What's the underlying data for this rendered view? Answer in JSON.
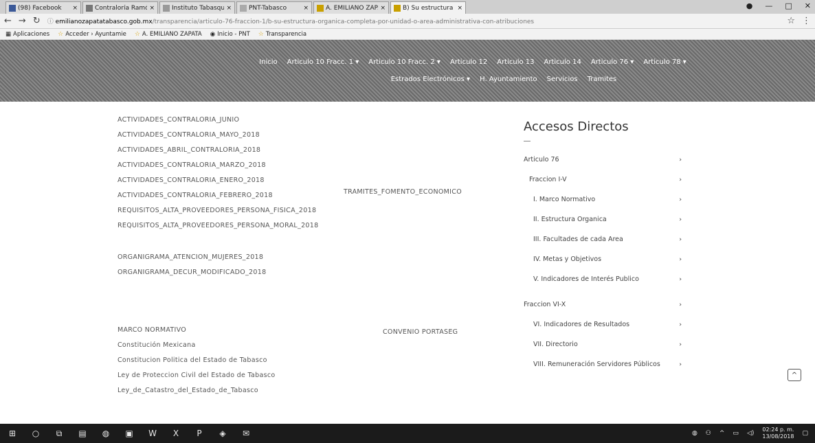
{
  "browser": {
    "tabs": [
      {
        "label": "(98) Facebook",
        "active": false
      },
      {
        "label": "Contraloría Ramón Solís",
        "active": false
      },
      {
        "label": "Instituto Tabasqueño de",
        "active": false
      },
      {
        "label": "PNT-Tabasco",
        "active": false
      },
      {
        "label": "A. EMILIANO ZAPATA",
        "active": false
      },
      {
        "label": "B) Su estructura orgánica",
        "active": true
      }
    ],
    "url_domain": "emilianozapatatabasco.gob.mx",
    "url_path": "/transparencia/articulo-76-fraccion-1/b-su-estructura-organica-completa-por-unidad-o-area-administrativa-con-atribuciones",
    "bookmarks": [
      "Aplicaciones",
      "Acceder › Ayuntamie",
      "A. EMILIANO ZAPATA",
      "Inicio - PNT",
      "Transparencia"
    ]
  },
  "site_nav": {
    "row1": [
      "Inicio",
      "Articulo 10 Fracc. 1 ▾",
      "Articulo 10 Fracc. 2 ▾",
      "Articulo 12",
      "Articulo 13",
      "Articulo 14",
      "Articulo 76 ▾",
      "Articulo 78 ▾"
    ],
    "row2": [
      "Estrados Electrónicos ▾",
      "H. Ayuntamiento",
      "Servicios",
      "Tramites"
    ]
  },
  "content": {
    "group1": [
      "ACTIVIDADES_CONTRALORIA_JUNIO",
      "ACTIVIDADES_CONTRALORIA_MAYO_2018",
      "ACTIVIDADES_ABRIL_CONTRALORIA_2018",
      "ACTIVIDADES_CONTRALORIA_MARZO_2018",
      "ACTIVIDADES_CONTRALORIA_ENERO_2018",
      "ACTIVIDADES_CONTRALORIA_FEBRERO_2018",
      "REQUISITOS_ALTA_PROVEEDORES_PERSONA_FISICA_2018",
      "REQUISITOS_ALTA_PROVEEDORES_PERSONA_MORAL_2018"
    ],
    "group2": [
      "ORGANIGRAMA_ATENCION_MUJERES_2018",
      "ORGANIGRAMA_DECUR_MODIFICADO_2018"
    ],
    "group3": [
      "MARCO NORMATIVO",
      "Constitución Mexicana",
      "Constitucion Politica del Estado de Tabasco",
      "Ley de Proteccion Civil del Estado de Tabasco",
      "Ley_de_Catastro_del_Estado_de_Tabasco"
    ],
    "mid_link_1": "TRAMITES_FOMENTO_ECONOMICO",
    "mid_link_2": "CONVENIO PORTASEG"
  },
  "sidebar": {
    "title": "Accesos Directos",
    "items": [
      {
        "label": "Articulo 76",
        "arrow": "›"
      },
      {
        "label": "Fraccion I-V",
        "arrow": "›"
      },
      {
        "label": "I. Marco Normativo",
        "arrow": "›"
      },
      {
        "label": "II. Estructura Organica",
        "arrow": "›"
      },
      {
        "label": "III. Facultades de cada Area",
        "arrow": "›"
      },
      {
        "label": "IV. Metas y Objetivos",
        "arrow": "›"
      },
      {
        "label": "V. Indicadores de Interés Publico",
        "arrow": "›"
      },
      {
        "label": "Fraccion VI-X",
        "arrow": "›"
      },
      {
        "label": "VI. Indicadores de Resultados",
        "arrow": "›"
      },
      {
        "label": "VII. Directorio",
        "arrow": "›"
      },
      {
        "label": "VIII. Remuneración Servidores Públicos",
        "arrow": "›"
      }
    ],
    "back_to_top": "^"
  },
  "taskbar": {
    "time": "02:24 p. m.",
    "date": "13/08/2018"
  }
}
